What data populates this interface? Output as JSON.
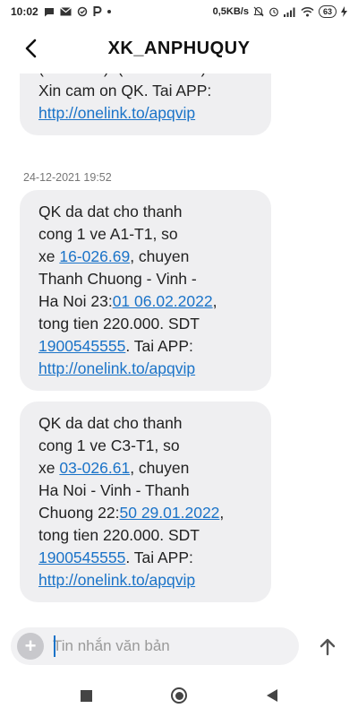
{
  "status_bar": {
    "time": "10:02",
    "net_speed": "0,5KB/s",
    "battery": "63"
  },
  "header": {
    "contact_name": "XK_ANPHUQUY"
  },
  "messages": [
    {
      "segments": [
        {
          "text": "(bat buoc): (SDT dat ve).\nXin cam on QK. Tai APP:\n"
        },
        {
          "text": "http://onelink.to/apqvip",
          "link": true
        }
      ]
    },
    {
      "timestamp": "24-12-2021 19:52",
      "segments": [
        {
          "text": "QK da dat cho thanh\ncong 1 ve A1-T1, so\nxe "
        },
        {
          "text": "16-026.69",
          "link": true
        },
        {
          "text": ", chuyen\nThanh Chuong - Vinh -\nHa Noi 23:"
        },
        {
          "text": "01 06.02.2022",
          "link": true
        },
        {
          "text": ",\ntong tien 220.000. SDT\n"
        },
        {
          "text": "1900545555",
          "link": true
        },
        {
          "text": ". Tai APP:\n"
        },
        {
          "text": "http://onelink.to/apqvip",
          "link": true
        }
      ]
    },
    {
      "segments": [
        {
          "text": "QK da dat cho thanh\ncong 1 ve C3-T1, so\nxe "
        },
        {
          "text": "03-026.61",
          "link": true
        },
        {
          "text": ", chuyen\nHa Noi - Vinh - Thanh\nChuong 22:"
        },
        {
          "text": "50 29.01.2022",
          "link": true
        },
        {
          "text": ",\ntong tien 220.000. SDT\n"
        },
        {
          "text": "1900545555",
          "link": true
        },
        {
          "text": ". Tai APP:\n"
        },
        {
          "text": "http://onelink.to/apqvip",
          "link": true
        }
      ]
    }
  ],
  "composer": {
    "placeholder": "Tin nhắn văn bản",
    "add_symbol": "+"
  },
  "colors": {
    "link": "#1a73c8",
    "bubble": "#efeff1",
    "caret": "#1a73c8"
  }
}
